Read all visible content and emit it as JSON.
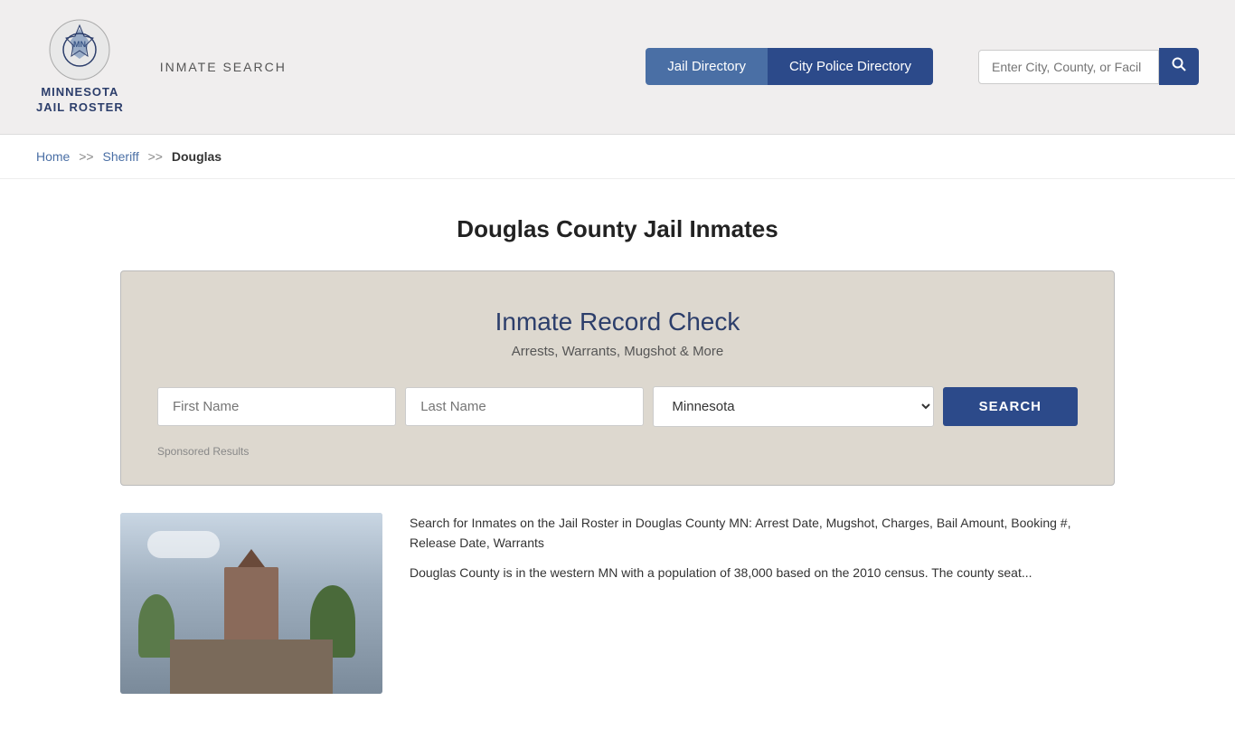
{
  "header": {
    "logo_line1": "MINNESOTA",
    "logo_line2": "JAIL ROSTER",
    "inmate_search_label": "INMATE SEARCH",
    "nav_jail_label": "Jail Directory",
    "nav_police_label": "City Police Directory",
    "search_placeholder": "Enter City, County, or Facil"
  },
  "breadcrumb": {
    "home": "Home",
    "sep1": ">>",
    "sheriff": "Sheriff",
    "sep2": ">>",
    "current": "Douglas"
  },
  "main": {
    "page_title": "Douglas County Jail Inmates",
    "record_check": {
      "title": "Inmate Record Check",
      "subtitle": "Arrests, Warrants, Mugshot & More",
      "first_name_placeholder": "First Name",
      "last_name_placeholder": "Last Name",
      "state_default": "Minnesota",
      "search_btn": "SEARCH",
      "sponsored": "Sponsored Results"
    },
    "bottom_text_1": "Search for Inmates on the Jail Roster in Douglas County MN: Arrest Date, Mugshot, Charges, Bail Amount, Booking #, Release Date, Warrants",
    "bottom_text_2": "Douglas County is in the western MN with a population of 38,000 based on the 2010 census. The county seat..."
  }
}
